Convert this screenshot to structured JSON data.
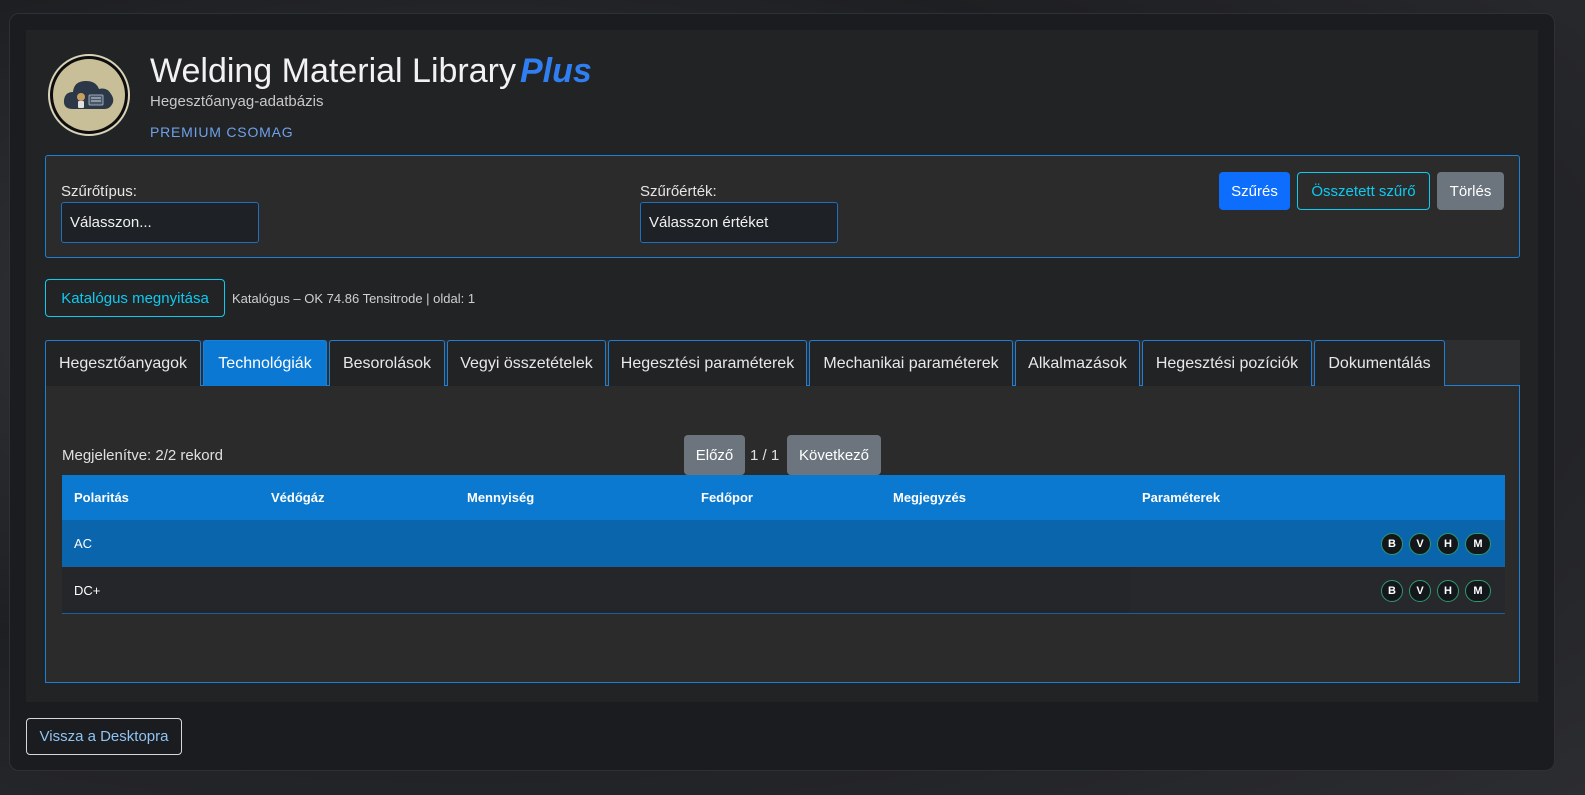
{
  "header": {
    "title": "Welding Material Library",
    "title_accent": "Plus",
    "subtitle": "Hegesztőanyag-adatbázis",
    "package": "PREMIUM CSOMAG"
  },
  "filter": {
    "type_label": "Szűrőtípus:",
    "type_value": "Válasszon...",
    "value_label": "Szűrőérték:",
    "value_value": "Válasszon értéket",
    "filter_button": "Szűrés",
    "complex_button": "Összetett szűrő",
    "clear_button": "Törlés"
  },
  "catalog": {
    "open_button": "Katalógus megnyitása",
    "info": "Katalógus – OK 74.86 Tensitrode | oldal: 1"
  },
  "tabs": [
    {
      "label": "Hegesztőanyagok",
      "active": false
    },
    {
      "label": "Technológiák",
      "active": true
    },
    {
      "label": "Besorolások",
      "active": false
    },
    {
      "label": "Vegyi összetételek",
      "active": false
    },
    {
      "label": "Hegesztési paraméterek",
      "active": false
    },
    {
      "label": "Mechanikai paraméterek",
      "active": false
    },
    {
      "label": "Alkalmazások",
      "active": false
    },
    {
      "label": "Hegesztési pozíciók",
      "active": false
    },
    {
      "label": "Dokumentálás",
      "active": false
    }
  ],
  "pagination": {
    "records": "Megjelenítve: 2/2 rekord",
    "prev": "Előző",
    "page": "1 / 1",
    "next": "Következő"
  },
  "table": {
    "columns": [
      "Polaritás",
      "Védőgáz",
      "Mennyiség",
      "Fedőpor",
      "Megjegyzés",
      "Paraméterek"
    ],
    "rows": [
      {
        "polaritas": "AC",
        "vedogaz": "",
        "mennyiseg": "",
        "fedopor": "",
        "megjegyzes": "",
        "badges": [
          "B",
          "V",
          "H",
          "M"
        ]
      },
      {
        "polaritas": "DC+",
        "vedogaz": "",
        "mennyiseg": "",
        "fedopor": "",
        "megjegyzes": "",
        "badges": [
          "B",
          "V",
          "H",
          "M"
        ]
      }
    ]
  },
  "footer": {
    "back_button": "Vissza a Desktopra"
  },
  "colors": {
    "accent": "#0d6efd",
    "tab_active": "#0b79d4",
    "border": "#1e7fd6",
    "badge_ring": "#2f9a6a"
  }
}
